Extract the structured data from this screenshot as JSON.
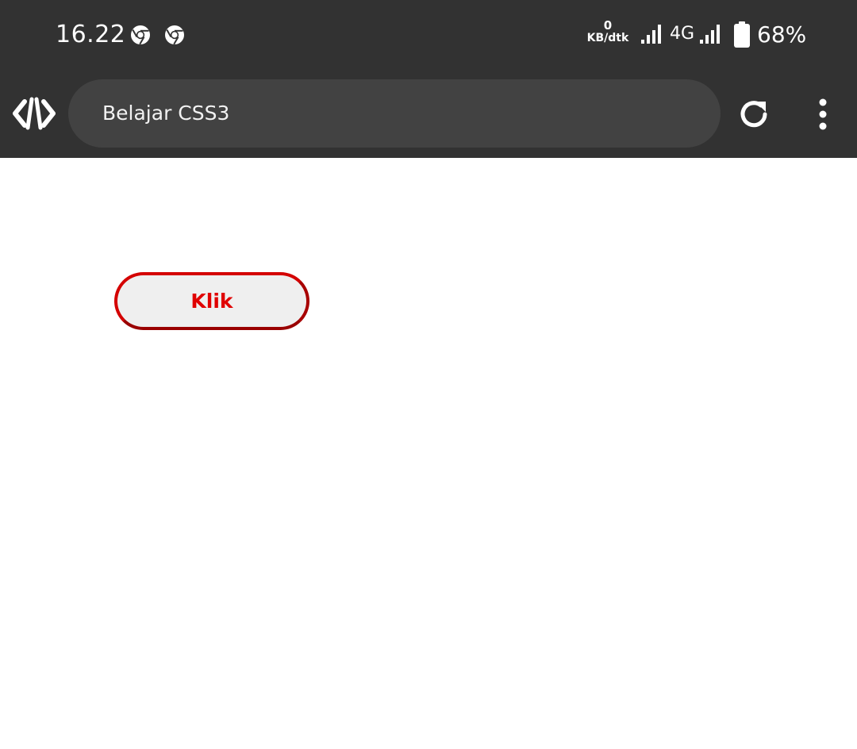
{
  "status_bar": {
    "time": "16.22",
    "notification_icons": [
      "chrome-icon",
      "chrome-icon"
    ],
    "net_speed_value": "0",
    "net_speed_unit": "KB/dtk",
    "network_type": "4G",
    "battery_percent": "68%"
  },
  "toolbar": {
    "app_icon": "code-icon",
    "url_title": "Belajar CSS3",
    "reload_icon": "reload-icon",
    "menu_icon": "more-vertical-icon"
  },
  "page": {
    "button_label": "Klik"
  },
  "colors": {
    "bar_background": "#323232",
    "url_bar_background": "#424242",
    "button_border": "#d40000",
    "button_text": "#e00000",
    "button_background": "#efefef"
  }
}
